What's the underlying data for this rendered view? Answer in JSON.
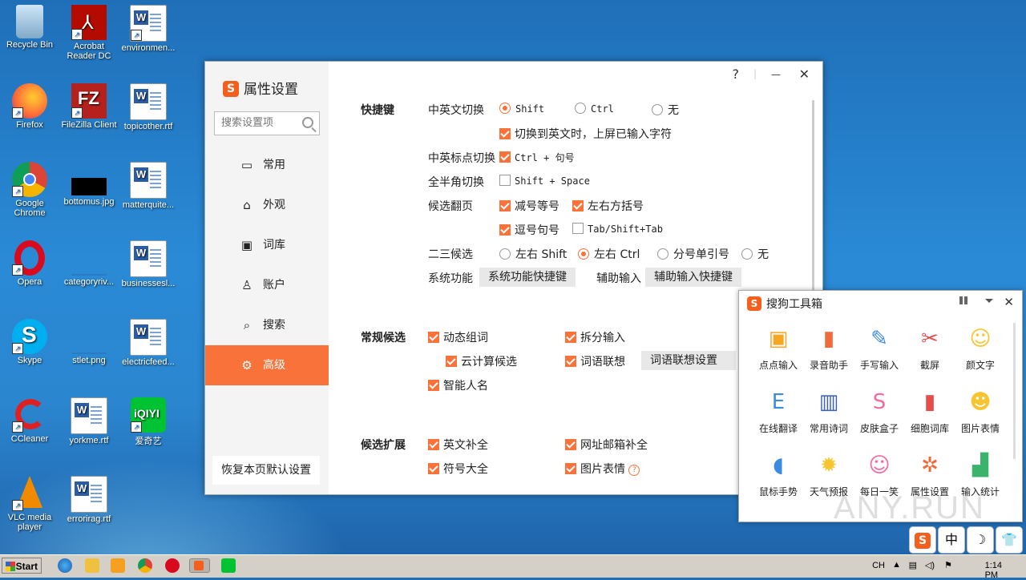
{
  "desktop": {
    "icons": [
      {
        "label": "Recycle Bin"
      },
      {
        "label": "Acrobat Reader DC"
      },
      {
        "label": "environmen..."
      },
      {
        "label": "Firefox"
      },
      {
        "label": "FileZilla Client"
      },
      {
        "label": "topicother.rtf"
      },
      {
        "label": "Google Chrome"
      },
      {
        "label": "bottomus.jpg"
      },
      {
        "label": "matterquite..."
      },
      {
        "label": "Opera"
      },
      {
        "label": "categoryriv..."
      },
      {
        "label": "businessesl..."
      },
      {
        "label": "Skype"
      },
      {
        "label": "stlet.png"
      },
      {
        "label": "electricfeed..."
      },
      {
        "label": "CCleaner"
      },
      {
        "label": "yorkme.rtf"
      },
      {
        "label": "爱奇艺"
      },
      {
        "label": "VLC media player"
      },
      {
        "label": "errorirag.rtf"
      }
    ],
    "watermark": "ANY.RUN"
  },
  "settings": {
    "brand_logo": "S",
    "title": "属性设置",
    "search_placeholder": "搜索设置项",
    "help": "?",
    "minimize": "—",
    "close": "✕",
    "nav": [
      {
        "label": "常用",
        "icon": "monitor-icon"
      },
      {
        "label": "外观",
        "icon": "shirt-icon"
      },
      {
        "label": "词库",
        "icon": "book-icon"
      },
      {
        "label": "账户",
        "icon": "user-icon"
      },
      {
        "label": "搜索",
        "icon": "search-icon"
      },
      {
        "label": "高级",
        "icon": "gear-icon"
      }
    ],
    "active_nav": "高级",
    "restore_label": "恢复本页默认设置",
    "shortcut": {
      "section": "快捷键",
      "cn_en_label": "中英文切换",
      "cn_en_options": [
        "Shift",
        "Ctrl",
        "无"
      ],
      "cn_en_selected": "Shift",
      "commit_on_switch": "切换到英文时，上屏已输入字符",
      "punct_label": "中英标点切换",
      "punct_option": "Ctrl + 句号",
      "width_label": "全半角切换",
      "width_option": "Shift + Space",
      "page_label": "候选翻页",
      "page_options": [
        "减号等号",
        "左右方括号",
        "逗号句号",
        "Tab/Shift+Tab"
      ],
      "second_label": "二三候选",
      "second_options": [
        "左右 Shift",
        "左右 Ctrl",
        "分号单引号",
        "无"
      ],
      "second_selected": "左右 Ctrl",
      "sys_label": "系统功能",
      "sys_button": "系统功能快捷键",
      "aux_label": "辅助输入",
      "aux_button": "辅助输入快捷键"
    },
    "candidate": {
      "section": "常规候选",
      "dynamic": "动态组词",
      "cloud": "云计算候选",
      "names": "智能人名",
      "split": "拆分输入",
      "assoc": "词语联想",
      "assoc_button": "词语联想设置"
    },
    "extend": {
      "section": "候选扩展",
      "english": "英文补全",
      "symbols": "符号大全",
      "email": "网址邮箱补全",
      "emoji": "图片表情"
    }
  },
  "toolbox": {
    "logo": "S",
    "title": "搜狗工具箱",
    "close": "✕",
    "tools": [
      {
        "label": "点点输入",
        "icon": "click-input-icon",
        "glyph": "▣",
        "color": "#f5a623"
      },
      {
        "label": "录音助手",
        "icon": "audio-icon",
        "glyph": "▮",
        "color": "#f06b3a"
      },
      {
        "label": "手写输入",
        "icon": "pen-icon",
        "glyph": "✎",
        "color": "#3b8be0"
      },
      {
        "label": "截屏",
        "icon": "scissors-icon",
        "glyph": "✂",
        "color": "#e94b4b"
      },
      {
        "label": "颜文字",
        "icon": "kaomoji-icon",
        "glyph": "☺",
        "color": "#f7c531"
      },
      {
        "label": "在线翻译",
        "icon": "translate-icon",
        "glyph": "E",
        "color": "#3b8be0"
      },
      {
        "label": "常用诗词",
        "icon": "poem-book-icon",
        "glyph": "▥",
        "color": "#3b5fc0"
      },
      {
        "label": "皮肤盒子",
        "icon": "skin-shirt-icon",
        "glyph": "S",
        "color": "#f06ba0"
      },
      {
        "label": "细胞词库",
        "icon": "dictionary-icon",
        "glyph": "▮",
        "color": "#e94b4b"
      },
      {
        "label": "图片表情",
        "icon": "smiley-icon",
        "glyph": "☻",
        "color": "#f7c531"
      },
      {
        "label": "鼠标手势",
        "icon": "mouse-icon",
        "glyph": "◖",
        "color": "#3b8be0"
      },
      {
        "label": "天气预报",
        "icon": "sun-icon",
        "glyph": "✹",
        "color": "#f7c531"
      },
      {
        "label": "每日一笑",
        "icon": "laugh-icon",
        "glyph": "☺",
        "color": "#f06ba0"
      },
      {
        "label": "属性设置",
        "icon": "settings-gear-icon",
        "glyph": "✲",
        "color": "#f06b3a"
      },
      {
        "label": "输入统计",
        "icon": "stats-icon",
        "glyph": "▟",
        "color": "#3bb36a"
      }
    ]
  },
  "ime_status": [
    "S",
    "中",
    "☽",
    "👕"
  ],
  "taskbar": {
    "start": "Start",
    "lang": "CH",
    "time": "1:14 PM"
  }
}
